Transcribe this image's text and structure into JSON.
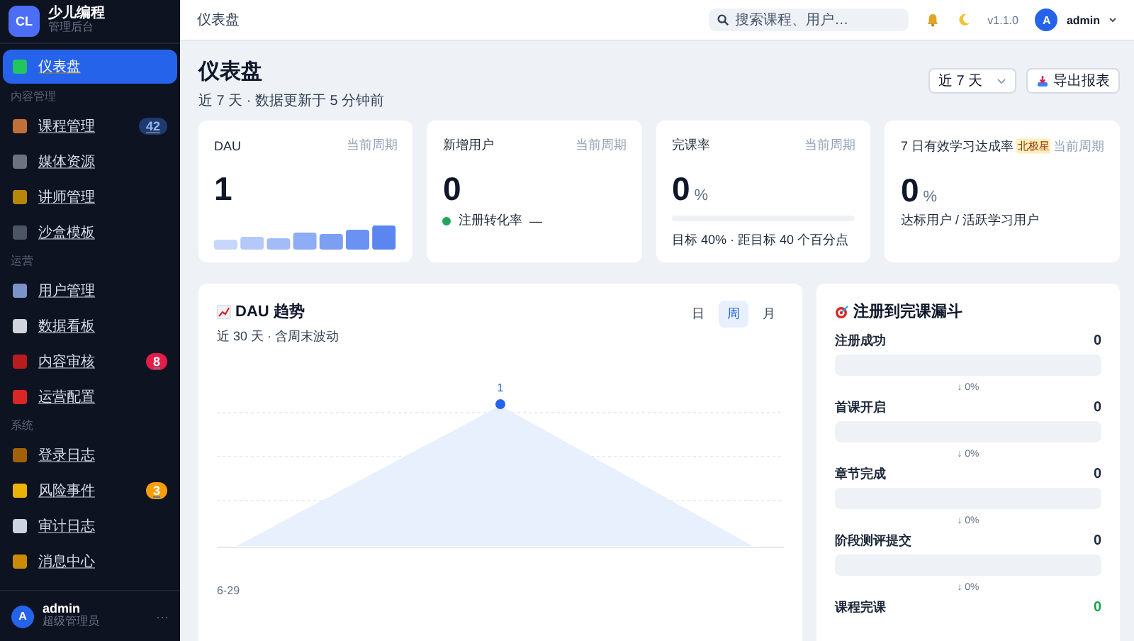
{
  "sidebar": {
    "logo": "CL",
    "brand": "少儿编程",
    "subtitle": "管理后台",
    "top_items": [
      {
        "label": "仪表盘",
        "selected": true
      }
    ],
    "sections": [
      {
        "title": "内容管理",
        "items": [
          {
            "label": "课程管理",
            "selected": false,
            "badge": "42",
            "color": "#1e3a6e"
          },
          {
            "label": "媒体资源",
            "selected": false
          },
          {
            "label": "讲师管理",
            "selected": false
          },
          {
            "label": "沙盒模板",
            "selected": false
          }
        ]
      },
      {
        "title": "运营",
        "items": [
          {
            "label": "用户管理",
            "selected": false
          },
          {
            "label": "数据看板",
            "selected": false
          },
          {
            "label": "内容审核",
            "selected": false,
            "badge": "8",
            "color": "#e11d48"
          },
          {
            "label": "运营配置",
            "selected": false
          }
        ]
      },
      {
        "title": "系统",
        "items": [
          {
            "label": "登录日志",
            "selected": false
          },
          {
            "label": "风险事件",
            "selected": false,
            "badge": "3",
            "color": "#f59e0b"
          },
          {
            "label": "审计日志",
            "selected": false
          },
          {
            "label": "消息中心",
            "selected": false
          }
        ]
      }
    ],
    "user": {
      "avatar": "A",
      "name": "admin",
      "role": "超级管理员",
      "more": "···"
    }
  },
  "topbar": {
    "breadcrumb": "仪表盘",
    "search": {
      "placeholder": "搜索课程、用户…"
    },
    "version": "v1.1.0",
    "avatar": "A",
    "user": "admin"
  },
  "header": {
    "title": "仪表盘",
    "subtitle": "近 7 天 · 数据更新于 5 分钟前",
    "range": "近 7 天",
    "export": "导出报表"
  },
  "cards": [
    {
      "kind": "bars",
      "title": "DAU",
      "period": "当前周期",
      "value": "1"
    },
    {
      "kind": "status",
      "title": "新增用户",
      "period": "当前周期",
      "value": "0",
      "status_label": "注册转化率",
      "status_value": "—",
      "color": "#22a55b"
    },
    {
      "kind": "progress",
      "title": "完课率",
      "period": "当前周期",
      "value": "0",
      "unit": "%",
      "level": 0,
      "caption": "目标 40% · 距目标 40 个百分点"
    },
    {
      "kind": "caption",
      "title": "7 日有效学习达成率",
      "badge": "北极星",
      "period": "当前周期",
      "value": "0",
      "unit": "%",
      "caption": "达标用户 / 活跃学习用户"
    }
  ],
  "trend": {
    "title": "DAU 趋势",
    "subtitle": "近 30 天 · 含周末波动",
    "tabs": [
      {
        "label": "日",
        "selected": false
      },
      {
        "label": "周",
        "selected": true
      },
      {
        "label": "月",
        "selected": false
      }
    ],
    "point_label": "1",
    "x_label": "6-29"
  },
  "funnel": {
    "title": "注册到完课漏斗",
    "steps": [
      {
        "kind": "stage",
        "label": "注册成功",
        "value": "0",
        "level": 0,
        "drop": "↓ 0%"
      },
      {
        "kind": "stage",
        "label": "首课开启",
        "value": "0",
        "level": 0,
        "drop": "↓ 0%"
      },
      {
        "kind": "stage",
        "label": "章节完成",
        "value": "0",
        "level": 0,
        "drop": "↓ 0%"
      },
      {
        "kind": "stage",
        "label": "阶段测评提交",
        "value": "0",
        "level": 0,
        "drop": "↓ 0%"
      },
      {
        "kind": "final",
        "label": "课程完课",
        "value": "0"
      }
    ]
  }
}
